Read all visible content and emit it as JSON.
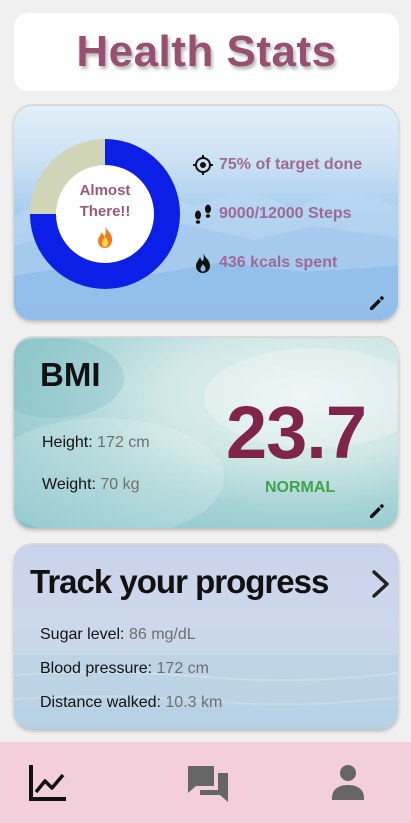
{
  "header": {
    "title": "Health Stats"
  },
  "activity": {
    "ring_label": "Almost There!!",
    "progress_fraction": 0.75,
    "ring_colors": {
      "done": "#0c1fe6",
      "remaining": "#cfd5b6"
    },
    "stats": [
      {
        "icon": "target-icon",
        "text": "75% of target done"
      },
      {
        "icon": "footsteps-icon",
        "text": "9000/12000 Steps"
      },
      {
        "icon": "flame-icon",
        "text": "436 kcals spent"
      }
    ]
  },
  "bmi": {
    "title": "BMI",
    "height_label": "Height:",
    "height_value": "172 cm",
    "weight_label": "Weight:",
    "weight_value": "70 kg",
    "value": "23.7",
    "status": "NORMAL"
  },
  "progress": {
    "title": "Track your progress",
    "rows": [
      {
        "label": "Sugar level:",
        "value": "86 mg/dL"
      },
      {
        "label": "Blood pressure:",
        "value": "172 cm"
      },
      {
        "label": "Distance walked:",
        "value": "10.3 km"
      }
    ]
  },
  "nav": {
    "items": [
      {
        "icon": "chart-icon",
        "active": true
      },
      {
        "icon": "chat-icon",
        "active": false
      },
      {
        "icon": "person-icon",
        "active": false
      }
    ]
  }
}
